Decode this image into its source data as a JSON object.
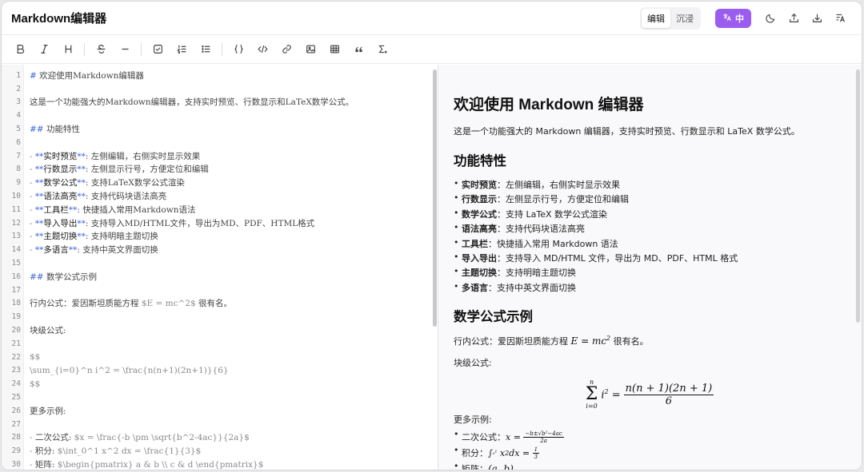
{
  "app": {
    "title": "Markdown编辑器"
  },
  "header": {
    "modes": [
      "编辑",
      "沉浸"
    ],
    "active_mode": "编辑",
    "language_label": "中"
  },
  "editor": {
    "lines": [
      "# 欢迎使用Markdown编辑器",
      "",
      "这是一个功能强大的Markdown编辑器，支持实时预览、行数显示和LaTeX数学公式。",
      "",
      "## 功能特性",
      "",
      "- **实时预览**: 左侧编辑，右侧实时显示效果",
      "- **行数显示**: 左侧显示行号，方便定位和编辑",
      "- **数学公式**: 支持LaTeX数学公式渲染",
      "- **语法高亮**: 支持代码块语法高亮",
      "- **工具栏**: 快捷插入常用Markdown语法",
      "- **导入导出**: 支持导入MD/HTML文件，导出为MD、PDF、HTML格式",
      "- **主题切换**: 支持明暗主题切换",
      "- **多语言**: 支持中英文界面切换",
      "",
      "## 数学公式示例",
      "",
      "行内公式：爱因斯坦质能方程 $E = mc^2$ 很有名。",
      "",
      "块级公式:",
      "",
      "$$",
      "\\sum_{i=0}^n i^2 = \\frac{n(n+1)(2n+1)}{6}",
      "$$",
      "",
      "更多示例:",
      "",
      "- 二次公式: $x = \\frac{-b \\pm \\sqrt{b^2-4ac}}{2a}$",
      "- 积分: $\\int_0^1 x^2 dx = \\frac{1}{3}$",
      "- 矩阵: $\\begin{pmatrix} a & b \\\\ c & d \\end{pmatrix}$"
    ]
  },
  "preview": {
    "h1": "欢迎使用 Markdown 编辑器",
    "intro": "这是一个功能强大的 Markdown 编辑器，支持实时预览、行数显示和 LaTeX 数学公式。",
    "features_title": "功能特性",
    "features": [
      {
        "name": "实时预览",
        "desc": "：左侧编辑，右侧实时显示效果"
      },
      {
        "name": "行数显示",
        "desc": "：左侧显示行号，方便定位和编辑"
      },
      {
        "name": "数学公式",
        "desc": "：支持 LaTeX 数学公式渲染"
      },
      {
        "name": "语法高亮",
        "desc": "：支持代码块语法高亮"
      },
      {
        "name": "工具栏",
        "desc": "：快捷插入常用 Markdown 语法"
      },
      {
        "name": "导入导出",
        "desc": "：支持导入 MD/HTML 文件，导出为 MD、PDF、HTML 格式"
      },
      {
        "name": "主题切换",
        "desc": "：支持明暗主题切换"
      },
      {
        "name": "多语言",
        "desc": "：支持中英文界面切换"
      }
    ],
    "math_title": "数学公式示例",
    "inline_prefix": "行内公式：爱因斯坦质能方程",
    "inline_formula": "E = mc²",
    "inline_suffix": "很有名。",
    "block_label": "块级公式:",
    "more_label": "更多示例:",
    "examples": [
      {
        "label": "二次公式："
      },
      {
        "label": "积分："
      },
      {
        "label": "矩阵："
      }
    ]
  },
  "colors": {
    "accent": "#9b5cf0",
    "markdown_mark": "#3b63d9",
    "line_number": "#8a8a8f"
  }
}
